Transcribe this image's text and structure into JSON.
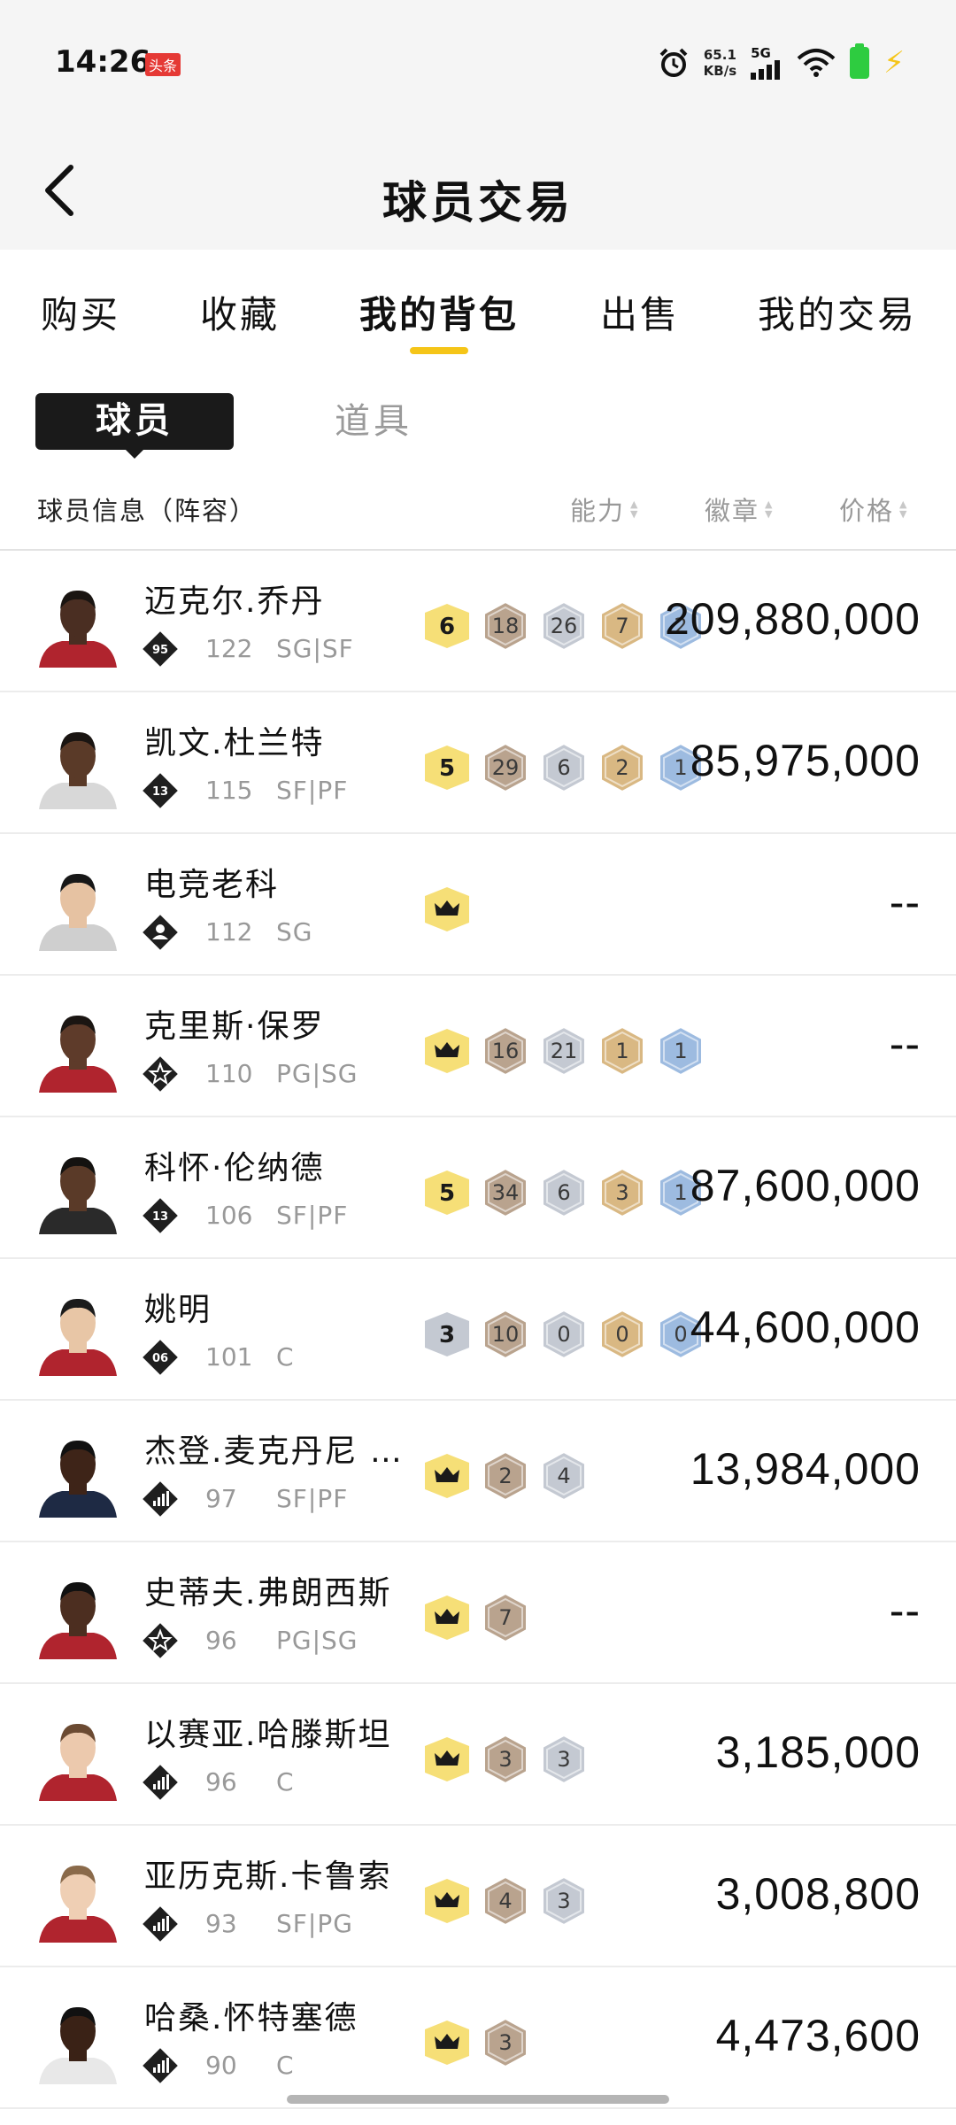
{
  "status_bar": {
    "time": "14:26",
    "app_badge": "头条",
    "net_speed_value": "65.1",
    "net_speed_unit": "KB/s",
    "signal_label": "5G"
  },
  "header": {
    "title": "球员交易"
  },
  "tabs": [
    {
      "label": "购买",
      "active": false
    },
    {
      "label": "收藏",
      "active": false
    },
    {
      "label": "我的背包",
      "active": true
    },
    {
      "label": "出售",
      "active": false
    },
    {
      "label": "我的交易",
      "active": false
    }
  ],
  "sub_tabs": [
    {
      "label": "球员",
      "active": true
    },
    {
      "label": "道具",
      "active": false
    }
  ],
  "columns": {
    "info": "球员信息（阵容）",
    "ability": "能力",
    "badge": "徽章",
    "price": "价格"
  },
  "players": [
    {
      "name": "迈克尔.乔丹",
      "rank": "95",
      "rank_icon": "number-rank-icon",
      "rating": "122",
      "position": "SG|SF",
      "skin": "#4a2e22",
      "hair": "#1a1512",
      "jersey": "#b0242e",
      "badges": [
        {
          "type": "level",
          "text": "6"
        },
        {
          "type": "bronze",
          "text": "18"
        },
        {
          "type": "silver",
          "text": "26"
        },
        {
          "type": "gold",
          "text": "7"
        },
        {
          "type": "blue",
          "text": "2"
        }
      ],
      "price": "209,880,000"
    },
    {
      "name": "凯文.杜兰特",
      "rank": "13",
      "rank_icon": "number-rank-icon",
      "rating": "115",
      "position": "SF|PF",
      "skin": "#5a3a28",
      "hair": "#1a1512",
      "jersey": "#d8d8d8",
      "badges": [
        {
          "type": "level",
          "text": "5"
        },
        {
          "type": "bronze",
          "text": "29"
        },
        {
          "type": "silver",
          "text": "6"
        },
        {
          "type": "gold",
          "text": "2"
        },
        {
          "type": "blue",
          "text": "1"
        }
      ],
      "price": "85,975,000"
    },
    {
      "name": "电竞老科",
      "rank": "",
      "rank_icon": "person-rank-icon",
      "rating": "112",
      "position": "SG",
      "skin": "#e6c2a2",
      "hair": "#171717",
      "jersey": "#cfcfcf",
      "badges": [
        {
          "type": "crown",
          "text": ""
        }
      ],
      "price": "--"
    },
    {
      "name": "克里斯·保罗",
      "rank": "",
      "rank_icon": "star-rank-icon",
      "rating": "110",
      "position": "PG|SG",
      "skin": "#5e3b2a",
      "hair": "#1a1512",
      "jersey": "#b0242e",
      "badges": [
        {
          "type": "crown",
          "text": ""
        },
        {
          "type": "bronze",
          "text": "16"
        },
        {
          "type": "silver",
          "text": "21"
        },
        {
          "type": "gold",
          "text": "1"
        },
        {
          "type": "blue",
          "text": "1"
        }
      ],
      "price": "--"
    },
    {
      "name": "科怀·伦纳德",
      "rank": "13",
      "rank_icon": "number-rank-icon",
      "rating": "106",
      "position": "SF|PF",
      "skin": "#5a3a28",
      "hair": "#141210",
      "jersey": "#2a2a2a",
      "badges": [
        {
          "type": "level",
          "text": "5"
        },
        {
          "type": "bronze",
          "text": "34"
        },
        {
          "type": "silver",
          "text": "6"
        },
        {
          "type": "gold",
          "text": "3"
        },
        {
          "type": "blue",
          "text": "1"
        }
      ],
      "price": "87,600,000"
    },
    {
      "name": "姚明",
      "rank": "06",
      "rank_icon": "number-rank-icon",
      "rating": "101",
      "position": "C",
      "skin": "#e8c6a6",
      "hair": "#1b1b1b",
      "jersey": "#b0242e",
      "badges": [
        {
          "type": "level-silver",
          "text": "3"
        },
        {
          "type": "bronze",
          "text": "10"
        },
        {
          "type": "silver",
          "text": "0"
        },
        {
          "type": "gold",
          "text": "0"
        },
        {
          "type": "blue",
          "text": "0"
        }
      ],
      "price": "44,600,000"
    },
    {
      "name": "杰登.麦克丹尼 …",
      "rank": "",
      "rank_icon": "bars-rank-icon",
      "rating": "97",
      "position": "SF|PF",
      "skin": "#3e2418",
      "hair": "#111",
      "jersey": "#1e2a44",
      "badges": [
        {
          "type": "crown",
          "text": ""
        },
        {
          "type": "bronze",
          "text": "2"
        },
        {
          "type": "silver",
          "text": "4"
        }
      ],
      "price": "13,984,000"
    },
    {
      "name": "史蒂夫.弗朗西斯",
      "rank": "",
      "rank_icon": "star-rank-icon",
      "rating": "96",
      "position": "PG|SG",
      "skin": "#4c2e20",
      "hair": "#111",
      "jersey": "#b0242e",
      "badges": [
        {
          "type": "crown",
          "text": ""
        },
        {
          "type": "bronze",
          "text": "7"
        }
      ],
      "price": "--"
    },
    {
      "name": "以赛亚.哈滕斯坦",
      "rank": "",
      "rank_icon": "bars-rank-icon",
      "rating": "96",
      "position": "C",
      "skin": "#ecc9ad",
      "hair": "#6b4a32",
      "jersey": "#b0242e",
      "badges": [
        {
          "type": "crown",
          "text": ""
        },
        {
          "type": "bronze",
          "text": "3"
        },
        {
          "type": "silver",
          "text": "3"
        }
      ],
      "price": "3,185,000"
    },
    {
      "name": "亚历克斯.卡鲁索",
      "rank": "",
      "rank_icon": "bars-rank-icon",
      "rating": "93",
      "position": "SF|PG",
      "skin": "#efcfb4",
      "hair": "#8a6a4a",
      "jersey": "#b0242e",
      "badges": [
        {
          "type": "crown",
          "text": ""
        },
        {
          "type": "bronze",
          "text": "4"
        },
        {
          "type": "silver",
          "text": "3"
        }
      ],
      "price": "3,008,800"
    },
    {
      "name": "哈桑.怀特塞德",
      "rank": "",
      "rank_icon": "bars-rank-icon",
      "rating": "90",
      "position": "C",
      "skin": "#3a2216",
      "hair": "#111",
      "jersey": "#e8e8e8",
      "badges": [
        {
          "type": "crown",
          "text": ""
        },
        {
          "type": "bronze",
          "text": "3"
        }
      ],
      "price": "4,473,600"
    }
  ],
  "colors": {
    "accent": "#f5c518",
    "level_badge": "#f6df77",
    "bronze_badge": "#b9a38e",
    "silver_badge": "#c4c9d2",
    "gold_badge": "#d9b883",
    "blue_badge": "#9dbbe0"
  }
}
